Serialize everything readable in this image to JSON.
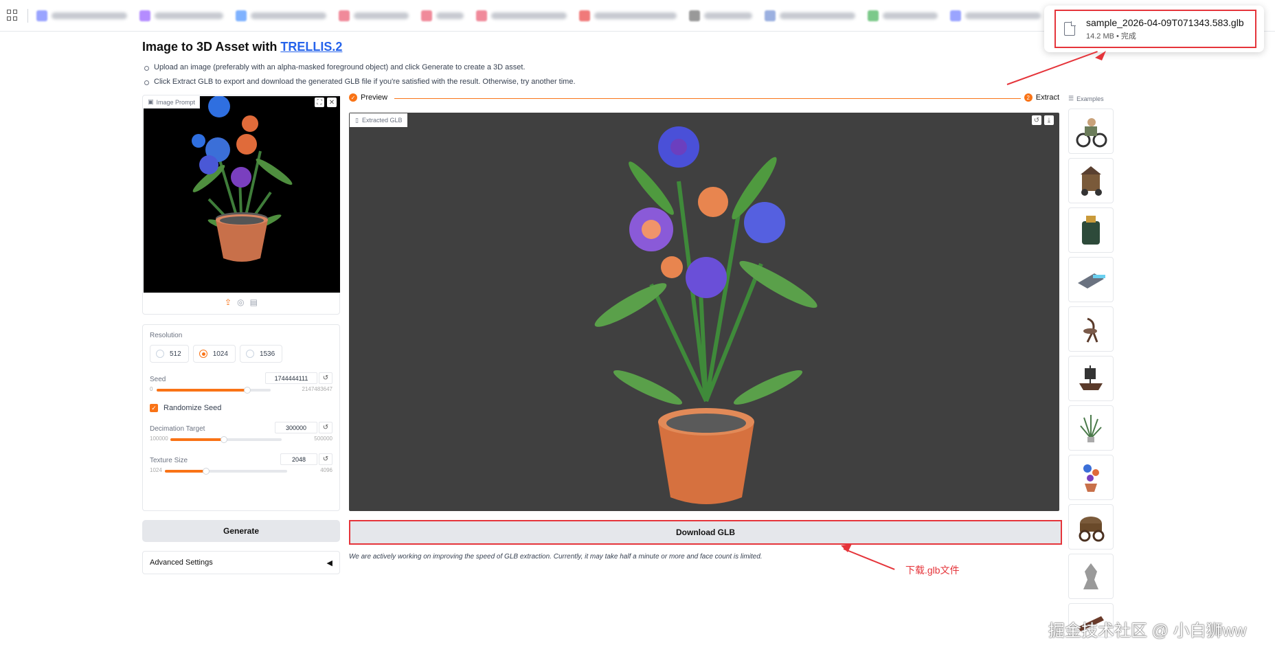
{
  "download": {
    "filename": "sample_2026-04-09T071343.583.glb",
    "meta": "14.2 MB • 完成"
  },
  "header": {
    "title_prefix": "Image to 3D Asset with ",
    "title_link": "TRELLIS.2",
    "bullets": [
      "Upload an image (preferably with an alpha-masked foreground object) and click Generate to create a 3D asset.",
      "Click Extract GLB to export and download the generated GLB file if you're satisfied with the result. Otherwise, try another time."
    ]
  },
  "image_prompt": {
    "label": "Image Prompt"
  },
  "settings": {
    "resolution_label": "Resolution",
    "resolutions": [
      "512",
      "1024",
      "1536"
    ],
    "resolution_selected": "1024",
    "seed_label": "Seed",
    "seed_value": "1744444111",
    "seed_min": "0",
    "seed_max": "2147483647",
    "randomize_label": "Randomize Seed",
    "randomize_checked": true,
    "decimation_label": "Decimation Target",
    "decimation_value": "300000",
    "decimation_min": "100000",
    "decimation_max": "500000",
    "texture_label": "Texture Size",
    "texture_value": "2048",
    "texture_min": "1024",
    "texture_max": "4096"
  },
  "buttons": {
    "generate": "Generate",
    "advanced": "Advanced Settings",
    "download_glb": "Download GLB"
  },
  "progress": {
    "left": "Preview",
    "right": "Extract",
    "right_step": "2"
  },
  "viewer": {
    "label": "Extracted GLB"
  },
  "note": "We are actively working on improving the speed of GLB extraction. Currently, it may take half a minute or more and face count is limited.",
  "annotation": "下载.glb文件",
  "examples": {
    "label": "Examples"
  },
  "watermark": "掘金技术社区 @ 小白狮ww",
  "colors": {
    "accent": "#f97316",
    "annotation_red": "#e5343a",
    "viewer_bg": "#404040"
  }
}
